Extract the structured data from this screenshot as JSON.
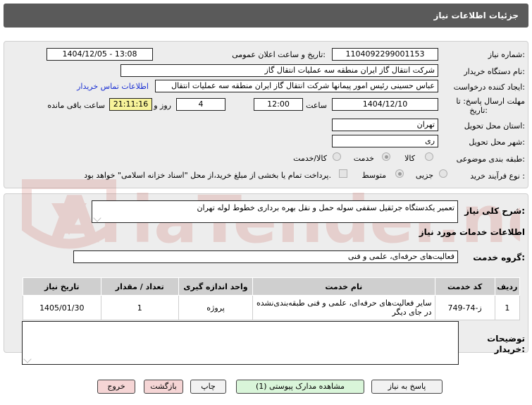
{
  "header": {
    "title": "جزئیات اطلاعات نیاز"
  },
  "form": {
    "need_number_label": "شماره نیاز:",
    "need_number": "1104092299001153",
    "announce_label": "تاریخ و ساعت اعلان عمومی:",
    "announce_value": "1404/12/05 - 13:08",
    "buyer_label": "نام دستگاه خریدار:",
    "buyer_value": "شرکت انتقال گاز ایران منطقه سه عملیات انتقال گاز",
    "creator_label": "ایجاد کننده درخواست:",
    "creator_value": "عباس حسینی رئیس امور پیمانها شرکت انتقال گاز ایران منطقه سه عملیات انتقال",
    "contact_link": "اطلاعات تماس خریدار",
    "deadline_label_line1": "مهلت ارسال پاسخ: تا",
    "deadline_label_line2": "تاریخ:",
    "deadline_date": "1404/12/10",
    "time_label": "ساعت",
    "deadline_time": "12:00",
    "days_value": "4",
    "days_and_label": "روز و",
    "remaining_time": "21:11:16",
    "remaining_label": "ساعت باقی مانده",
    "province_label": "استان محل تحویل:",
    "province_value": "تهران",
    "city_label": "شهر محل تحویل:",
    "city_value": "ری",
    "category_label": "طبقه بندی موضوعی:",
    "category_options": [
      "کالا",
      "خدمت",
      "کالا/خدمت"
    ],
    "purchase_type_label": "نوع فرآیند خرید :",
    "purchase_options": [
      "جزیی",
      "متوسط"
    ],
    "payment_note": "پرداخت تمام یا بخشی از مبلغ خرید،از محل \"اسناد خزانه اسلامی\" خواهد بود."
  },
  "details": {
    "summary_label": "شرح کلی نیاز:",
    "summary_value": "تعمیر یکدستگاه جرثقیل سقفی سوله حمل و نقل بهره برداری خطوط لوله تهران",
    "services_info_title": "اطلاعات خدمات مورد نیاز",
    "service_group_label": "گروه خدمت:",
    "service_group_value": "فعالیت‌های حرفه‌ای، علمی و فنی",
    "table": {
      "headers": [
        "ردیف",
        "کد خدمت",
        "نام خدمت",
        "واحد اندازه گیری",
        "تعداد / مقدار",
        "تاریخ نیاز"
      ],
      "rows": [
        {
          "row": "1",
          "code": "ز-74-749",
          "name": "سایر فعالیت‌های حرفه‌ای، علمی و فنی طبقه‌بندی‌نشده در جای دیگر",
          "unit": "پروژه",
          "qty": "1",
          "date": "1405/01/30"
        }
      ]
    },
    "buyer_notes_label_line1": "توضیحات",
    "buyer_notes_label_line2": "خریدار:"
  },
  "buttons": {
    "reply": "پاسخ به نیاز",
    "attachments": "مشاهده مدارک پیوستی (1)",
    "print": "چاپ",
    "back": "بازگشت",
    "exit": "خروج"
  },
  "watermark": {
    "text": "AriaTender.net"
  },
  "colors": {
    "header_bg": "#5a5a5a",
    "panel_bg": "#ededed",
    "highlight": "#f7f39a",
    "link": "#1a2fd3",
    "watermark": "#c0392b"
  }
}
